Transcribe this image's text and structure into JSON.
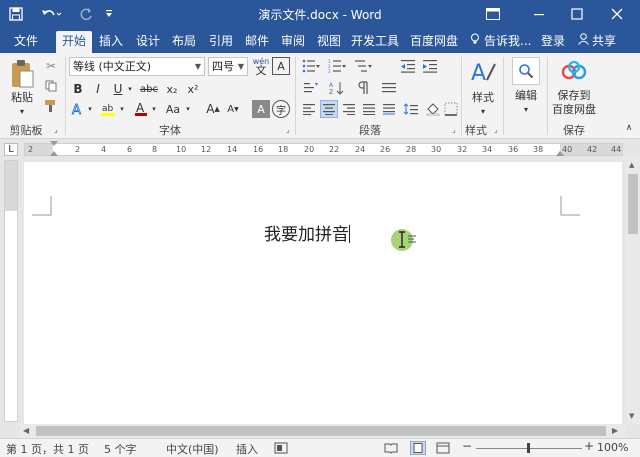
{
  "window": {
    "title": "演示文件.docx - Word"
  },
  "quick_access": {
    "save_icon": "save-icon",
    "undo_icon": "undo-icon",
    "redo_icon": "redo-icon",
    "customize_icon": "customize-icon"
  },
  "tabs": [
    {
      "label": "文件"
    },
    {
      "label": "开始"
    },
    {
      "label": "插入"
    },
    {
      "label": "设计"
    },
    {
      "label": "布局"
    },
    {
      "label": "引用"
    },
    {
      "label": "邮件"
    },
    {
      "label": "审阅"
    },
    {
      "label": "视图"
    },
    {
      "label": "开发工具"
    },
    {
      "label": "百度网盘"
    }
  ],
  "tell_me": "告诉我...",
  "login": "登录",
  "share": "共享",
  "ribbon": {
    "clipboard": {
      "label": "剪贴板",
      "paste": "粘贴"
    },
    "font": {
      "label": "字体",
      "font_name": "等线 (中文正文)",
      "font_size": "四号",
      "wen": "wén",
      "wen_char": "文",
      "box_a": "A",
      "bold": "B",
      "italic": "I",
      "underline": "U",
      "strike": "abc",
      "sub": "x₂",
      "sup": "x²",
      "aa": "Aa",
      "grow": "A",
      "shrink": "A",
      "char_shade": "A",
      "circle": "字"
    },
    "paragraph": {
      "label": "段落"
    },
    "styles": {
      "label": "样式",
      "button": "样式"
    },
    "edit": {
      "button": "编辑"
    },
    "save": {
      "label": "保存",
      "button_line1": "保存到",
      "button_line2": "百度网盘"
    }
  },
  "ruler": {
    "numbers": [
      "2",
      "2",
      "4",
      "6",
      "8",
      "10",
      "12",
      "14",
      "16",
      "18",
      "20",
      "22",
      "24",
      "26",
      "28",
      "30",
      "32",
      "34",
      "36",
      "38",
      "40",
      "42",
      "44"
    ],
    "left_label": "L"
  },
  "document": {
    "text": "我要加拼音"
  },
  "status": {
    "page": "第 1 页，共 1 页",
    "words": "5 个字",
    "language": "中文(中国)",
    "mode": "插入",
    "zoom": "100%"
  },
  "colors": {
    "accent": "#2b579a",
    "highlight": "#ffff00",
    "font_color": "#c00000",
    "cursor_dot": "#8bc34a"
  }
}
